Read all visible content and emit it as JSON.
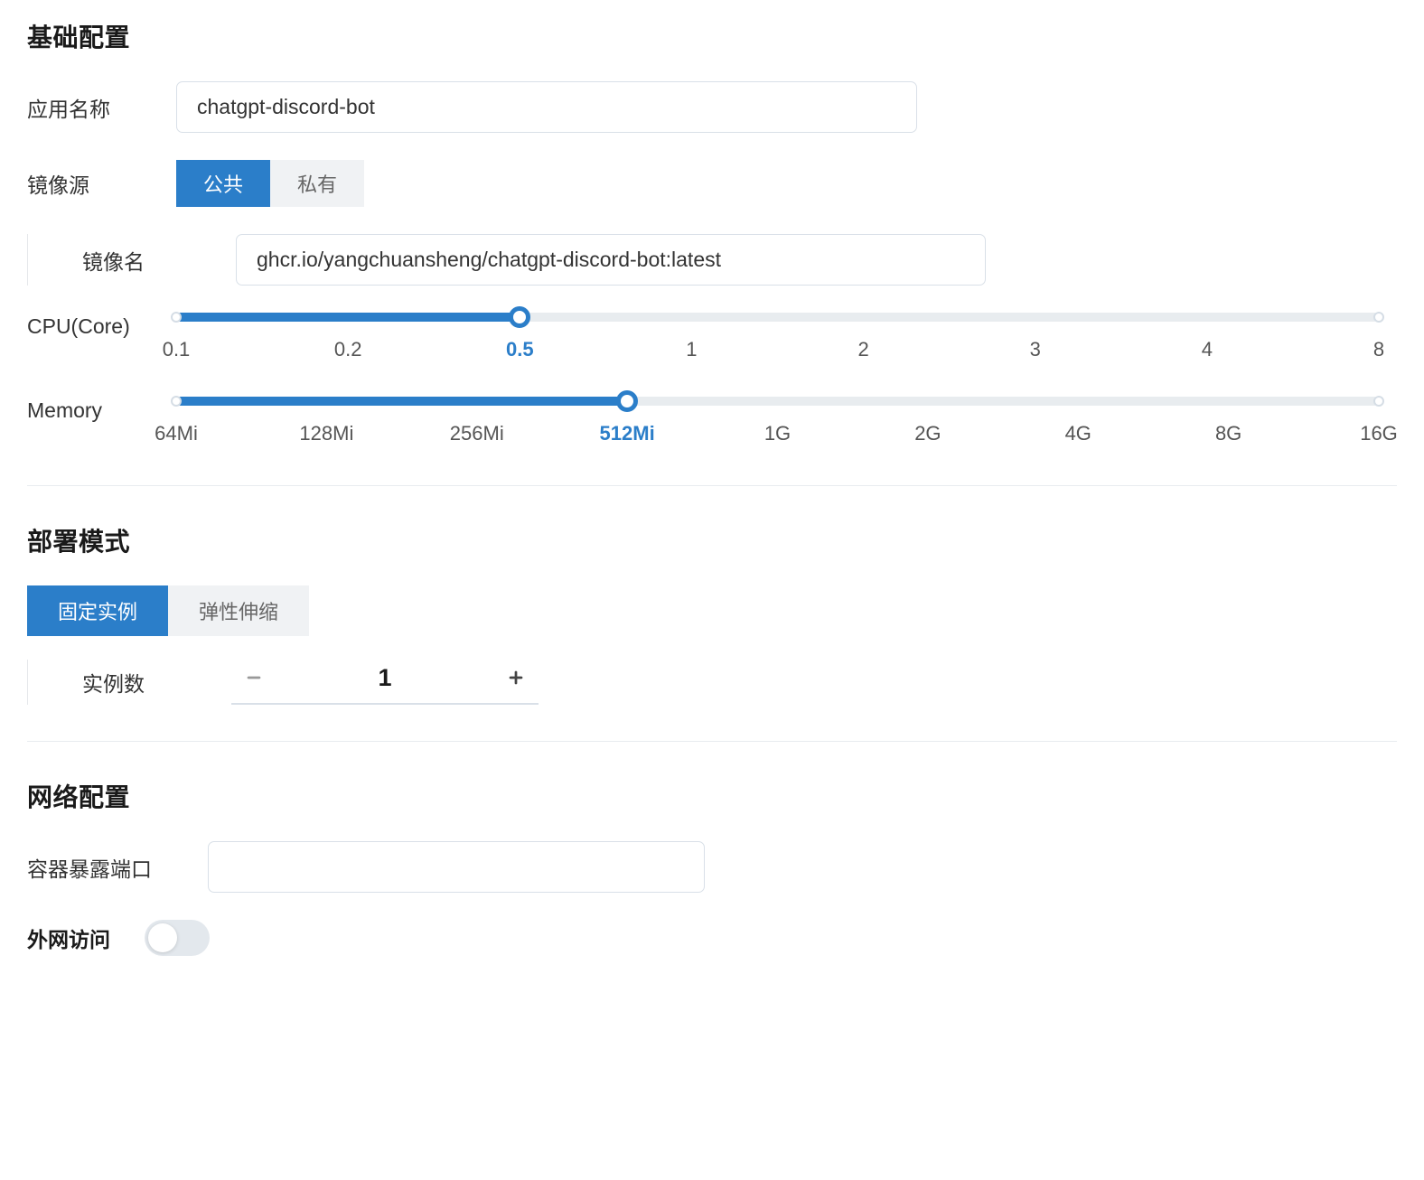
{
  "basic": {
    "title": "基础配置",
    "app_name_label": "应用名称",
    "app_name_value": "chatgpt-discord-bot",
    "image_source_label": "镜像源",
    "image_source_tabs": {
      "public": "公共",
      "private": "私有"
    },
    "image_name_label": "镜像名",
    "image_name_value": "ghcr.io/yangchuansheng/chatgpt-discord-bot:latest",
    "cpu_label": "CPU(Core)",
    "cpu_ticks": [
      "0.1",
      "0.2",
      "0.5",
      "1",
      "2",
      "3",
      "4",
      "8"
    ],
    "cpu_selected_index": 2,
    "memory_label": "Memory",
    "memory_ticks": [
      "64Mi",
      "128Mi",
      "256Mi",
      "512Mi",
      "1G",
      "2G",
      "4G",
      "8G",
      "16G"
    ],
    "memory_selected_index": 3
  },
  "deploy": {
    "title": "部署模式",
    "tabs": {
      "fixed": "固定实例",
      "autoscale": "弹性伸缩"
    },
    "instance_count_label": "实例数",
    "instance_count_value": "1"
  },
  "network": {
    "title": "网络配置",
    "port_label": "容器暴露端口",
    "port_value": "",
    "external_access_label": "外网访问",
    "external_access_on": false
  }
}
